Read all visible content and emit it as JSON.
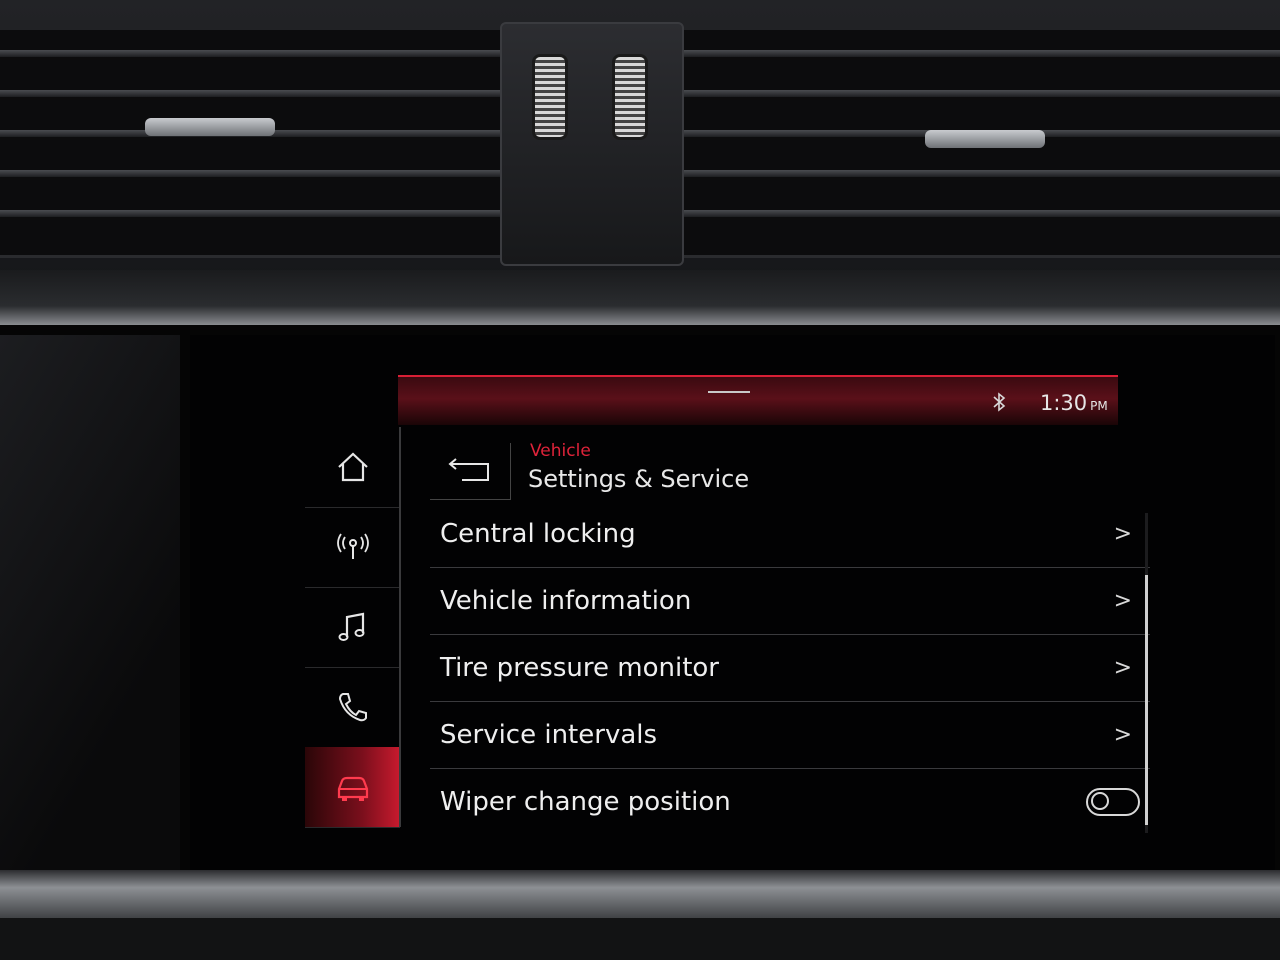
{
  "status": {
    "time": "1:30",
    "ampm": "PM"
  },
  "header": {
    "breadcrumb": "Vehicle",
    "title": "Settings & Service"
  },
  "sidebar": {
    "items": [
      {
        "icon": "home-icon"
      },
      {
        "icon": "radio-icon"
      },
      {
        "icon": "music-icon"
      },
      {
        "icon": "phone-icon"
      },
      {
        "icon": "car-icon",
        "active": true
      }
    ]
  },
  "list": {
    "items": [
      {
        "label": "Central locking",
        "control": ">"
      },
      {
        "label": "Vehicle information",
        "control": ">"
      },
      {
        "label": "Tire pressure monitor",
        "control": ">"
      },
      {
        "label": "Service intervals",
        "control": ">"
      },
      {
        "label": "Wiper change position",
        "control": "toggle",
        "toggle_on": false
      }
    ]
  },
  "colors": {
    "accent_red": "#e0233a",
    "text": "#efefef"
  }
}
